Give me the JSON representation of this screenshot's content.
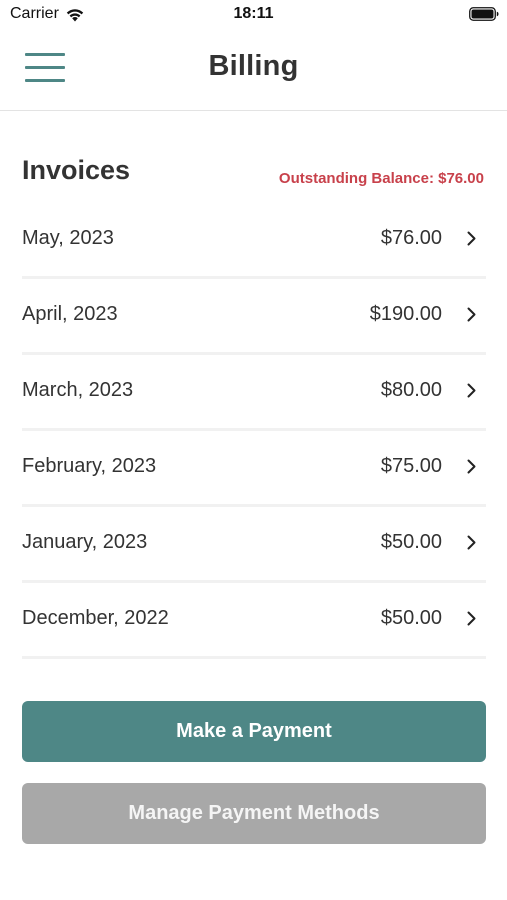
{
  "status_bar": {
    "carrier": "Carrier",
    "time": "18:11",
    "icons": [
      "wifi-icon",
      "battery-icon"
    ]
  },
  "header": {
    "title": "Billing",
    "menu_icon": "hamburger-menu-icon"
  },
  "invoices": {
    "title": "Invoices",
    "outstanding_balance": "Outstanding Balance: $76.00",
    "items": [
      {
        "date": "May, 2023",
        "amount": "$76.00"
      },
      {
        "date": "April, 2023",
        "amount": "$190.00"
      },
      {
        "date": "March, 2023",
        "amount": "$80.00"
      },
      {
        "date": "February, 2023",
        "amount": "$75.00"
      },
      {
        "date": "January, 2023",
        "amount": "$50.00"
      },
      {
        "date": "December, 2022",
        "amount": "$50.00"
      }
    ]
  },
  "actions": {
    "make_payment": "Make a Payment",
    "manage_methods": "Manage Payment Methods"
  },
  "colors": {
    "accent": "#4e8786",
    "balance_red": "#c8414b",
    "disabled_gray": "#a8a8a8"
  }
}
